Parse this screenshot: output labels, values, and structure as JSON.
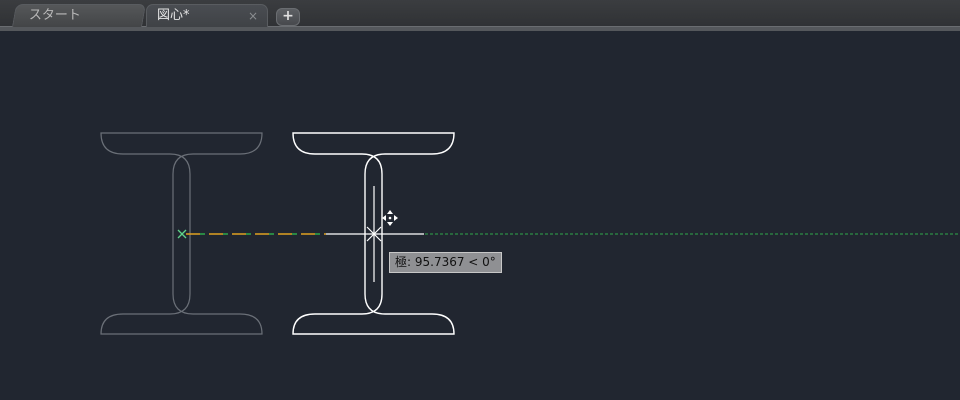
{
  "tabs": [
    {
      "label": "スタート",
      "active": false
    },
    {
      "label": "図心*",
      "active": true,
      "close_icon": "×"
    }
  ],
  "add_tab_label": "+",
  "tooltip": {
    "text": "極: 95.7367 < 0°"
  },
  "colors": {
    "canvas_background": "#212630",
    "ghost_shape": "#6b7078",
    "active_shape": "#ffffff",
    "tracking_line": "#2ea84a",
    "rubber_band": "#e0a020",
    "rubber_band_dash": "#2ea84a"
  },
  "icons": {
    "add_tab": "plus-icon",
    "close_tab": "close-icon",
    "cursor": "crosshair-cursor-icon",
    "move_grip": "move-grip-icon",
    "base_point": "base-point-marker-icon"
  }
}
